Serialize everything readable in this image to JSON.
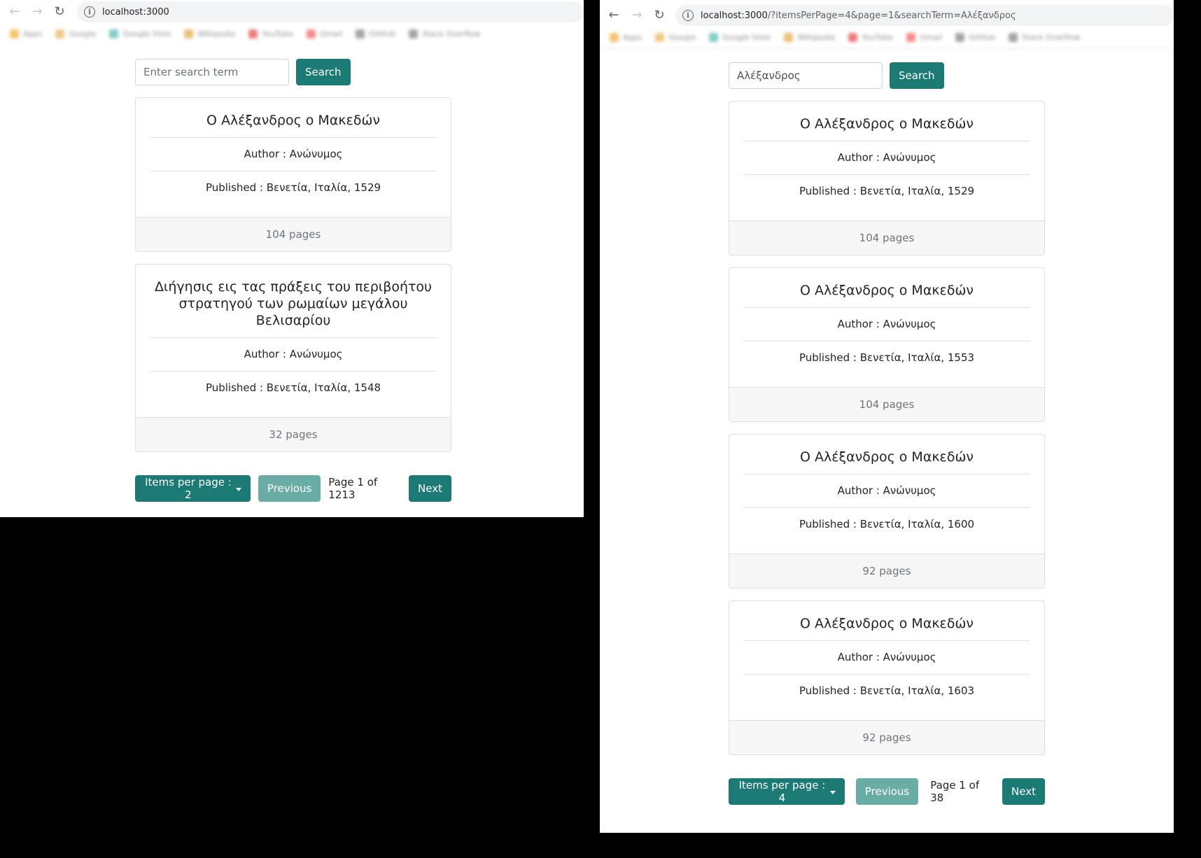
{
  "left": {
    "url": {
      "host": "localhost:3000",
      "rest": ""
    },
    "search": {
      "placeholder": "Enter search term",
      "value": "",
      "button": "Search"
    },
    "books": [
      {
        "title": "Ο Αλέξανδρος ο Μακεδών",
        "author": "Author : Ανώνυμος",
        "published": "Published : Βενετία, Ιταλία, 1529",
        "pages": "104 pages"
      },
      {
        "title": "Διήγησις εις τας πράξεις του περιβοήτου στρατηγού των ρωμαίων μεγάλου Βελισαρίου",
        "author": "Author : Ανώνυμος",
        "published": "Published : Βενετία, Ιταλία, 1548",
        "pages": "32 pages"
      }
    ],
    "pager": {
      "items_per_page": "Items per page : 2",
      "previous": "Previous",
      "page_info": "Page 1 of 1213",
      "next": "Next"
    }
  },
  "right": {
    "url": {
      "host": "localhost:3000",
      "rest": "/?itemsPerPage=4&page=1&searchTerm=Αλέξανδρος"
    },
    "search": {
      "placeholder": "Enter search term",
      "value": "Αλέξανδρος",
      "button": "Search"
    },
    "books": [
      {
        "title": "Ο Αλέξανδρος ο Μακεδών",
        "author": "Author : Ανώνυμος",
        "published": "Published : Βενετία, Ιταλία, 1529",
        "pages": "104 pages"
      },
      {
        "title": "Ο Αλέξανδρος ο Μακεδών",
        "author": "Author : Ανώνυμος",
        "published": "Published : Βενετία, Ιταλία, 1553",
        "pages": "104 pages"
      },
      {
        "title": "Ο Αλέξανδρος ο Μακεδών",
        "author": "Author : Ανώνυμος",
        "published": "Published : Βενετία, Ιταλία, 1600",
        "pages": "92 pages"
      },
      {
        "title": "Ο Αλέξανδρος ο Μακεδών",
        "author": "Author : Ανώνυμος",
        "published": "Published : Βενετία, Ιταλία, 1603",
        "pages": "92 pages"
      }
    ],
    "pager": {
      "items_per_page": "Items per page : 4",
      "previous": "Previous",
      "page_info": "Page 1 of 38",
      "next": "Next"
    }
  },
  "icons": {
    "back": "arrow-left-icon",
    "forward": "arrow-right-icon",
    "reload": "reload-icon",
    "site_info": "info-icon"
  },
  "colors": {
    "primary": "#1b7a73",
    "primary_disabled": "#6aada7",
    "card_footer": "#f7f7f7",
    "page_background": "#000000"
  }
}
